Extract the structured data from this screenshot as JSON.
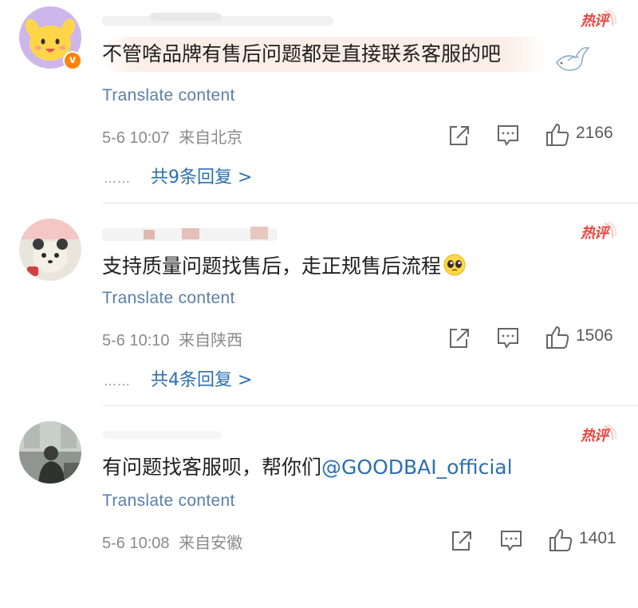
{
  "comments": [
    {
      "text": "不管啥品牌有售后问题都是直接联系客服的吧",
      "translate": "Translate content",
      "time": "5-6 10:07",
      "location": "来自北京",
      "likes": "2166",
      "replies": "共9条回复 >",
      "hot": "热评",
      "verified": true
    },
    {
      "text": "支持质量问题找售后，走正规售后流程",
      "translate": "Translate content",
      "time": "5-6 10:10",
      "location": "来自陕西",
      "likes": "1506",
      "replies": "共4条回复 >",
      "hot": "热评"
    },
    {
      "text": "有问题找客服呗，帮你们",
      "mention": "@GOODBAI_official",
      "translate": "Translate content",
      "time": "5-6 10:08",
      "location": "来自安徽",
      "likes": "1401",
      "hot": "热评"
    }
  ],
  "ui": {
    "replies_dots": "……",
    "verified_mark": "v"
  },
  "colors": {
    "link": "#2b6fb1",
    "translate": "#5b80a8",
    "hot": "#e8463f",
    "verified": "#ff8200",
    "meta": "#8a8a8a"
  },
  "icons": [
    "share-icon",
    "comment-icon",
    "like-icon",
    "dove-icon",
    "pleading-face-emoji"
  ]
}
